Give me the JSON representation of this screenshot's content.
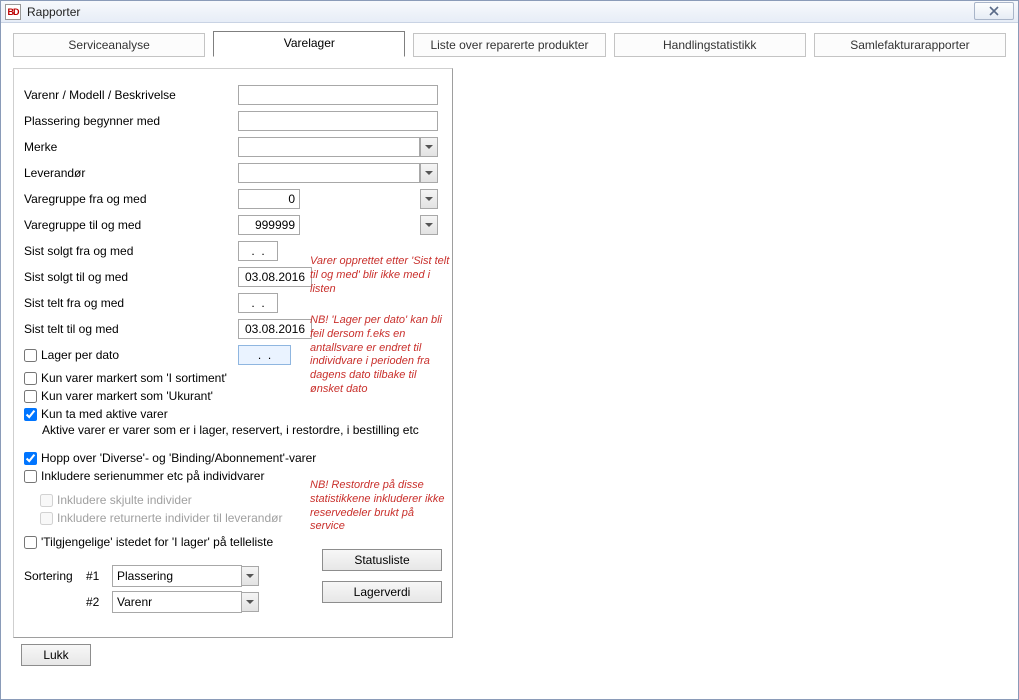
{
  "title": "Rapporter",
  "tabs": {
    "serviceanalyse": "Serviceanalyse",
    "varelager": "Varelager",
    "reparterte": "Liste over reparerte produkter",
    "handling": "Handlingstatistikk",
    "samle": "Samlefakturarapporter"
  },
  "labels": {
    "varenr": "Varenr / Modell / Beskrivelse",
    "plassering": "Plassering begynner med",
    "merke": "Merke",
    "leverandor": "Leverandør",
    "vgfra": "Varegruppe fra og med",
    "vgtil": "Varegruppe til og med",
    "sistSolgtFra": "Sist solgt fra og med",
    "sistSolgtTil": "Sist solgt til og med",
    "sistTeltFra": "Sist telt fra og med",
    "sistTeltTil": "Sist telt til og med",
    "lagerPerDato": "Lager per dato",
    "kunSortiment": "Kun varer markert som 'I sortiment'",
    "kunUkurant": "Kun varer markert som 'Ukurant'",
    "kunAktive": "Kun ta med aktive varer",
    "aktiveSub": "Aktive varer er varer som er i lager, reservert, i restordre, i bestilling etc",
    "hoppover": "Hopp over 'Diverse'- og 'Binding/Abonnement'-varer",
    "inklSerie": "Inkludere serienummer etc på individvarer",
    "inklSkjulte": "Inkludere skjulte individer",
    "inklRetur": "Inkludere returnerte individer til leverandør",
    "tilgjengelige": "'Tilgjengelige' istedet for 'I lager' på telleliste",
    "sortering": "Sortering",
    "sort1": "#1",
    "sort2": "#2"
  },
  "values": {
    "varenr": "",
    "plassering": "",
    "merke": "",
    "leverandor": "",
    "vgfra": "0",
    "vgtil": "999999",
    "sistSolgtFra": ".  .",
    "sistSolgtTil": "03.08.2016",
    "sistTeltFra": ".  .",
    "sistTeltTil": "03.08.2016",
    "lagerDato": ".  .",
    "sort1": "Plassering",
    "sort2": "Varenr"
  },
  "notes": {
    "n1": "Varer opprettet etter 'Sist telt til og med' blir ikke med i listen",
    "n2": "NB! 'Lager per dato' kan bli feil dersom f.eks en antallsvare er endret til individvare i perioden fra dagens dato tilbake til ønsket dato",
    "n3": "NB! Restordre på disse statistikkene inkluderer ikke reservedeler brukt på service"
  },
  "buttons": {
    "status": "Statusliste",
    "verdi": "Lagerverdi",
    "lukk": "Lukk"
  }
}
